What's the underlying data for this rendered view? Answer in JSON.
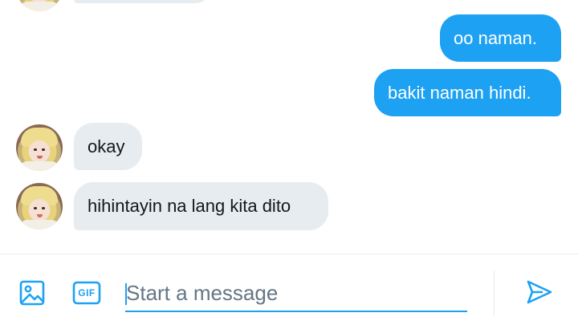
{
  "messages": [
    {
      "direction": "incoming",
      "text": ""
    },
    {
      "direction": "outgoing",
      "text": "oo naman."
    },
    {
      "direction": "outgoing",
      "text": "bakit naman hindi."
    },
    {
      "direction": "incoming",
      "text": "okay"
    },
    {
      "direction": "incoming",
      "text": "hihintayin na lang kita dito"
    }
  ],
  "composer": {
    "placeholder": "Start a message",
    "value": ""
  },
  "icons": {
    "image": "image-icon",
    "gif": "gif-icon",
    "send": "send-icon"
  },
  "labels": {
    "gif": "GIF"
  },
  "colors": {
    "accent": "#1da1f2",
    "incoming_bubble": "#e6ecf0",
    "text": "#14171a",
    "placeholder": "#657786"
  }
}
